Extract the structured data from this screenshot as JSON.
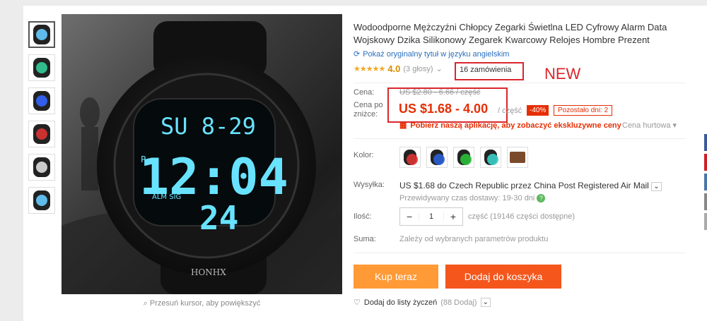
{
  "product": {
    "title": "Wodoodporne Mężczyźni Chłopcy Zegarki Świetlna LED Cyfrowy Alarm Data Wojskowy Dzika Silikonowy Zegarek Kwarcowy Relojes Hombre Prezent",
    "original_title_link": "Pokaż oryginalny tytuł w języku angielskim",
    "stars": "★★★★★",
    "rating": "4.0",
    "votes": "(3 głosy)",
    "orders": "16 zamówienia",
    "annotation": "NEW"
  },
  "pricing": {
    "price_label": "Cena:",
    "old_price": "US $2.80 - 6.66 / część",
    "discount_label": "Cena po zniżce:",
    "price": "US $1.68 - 4.00",
    "unit": "/ część",
    "discount": "-40%",
    "remaining": "Pozostało dni: 2",
    "app_promo": "Pobierz naszą aplikację, aby zobaczyć ekskluzywne ceny",
    "wholesale": "Cena hurtowa ▾"
  },
  "options": {
    "color_label": "Kolor:",
    "colors": [
      "#d33",
      "#2a5fd6",
      "#2bbf3a",
      "#3ad0c8",
      "#7a4b2b"
    ]
  },
  "shipping": {
    "label": "Wysyłka:",
    "text": "US $1.68 do Czech Republic przez China Post Registered Air Mail",
    "delivery": "Przewidywany czas dostawy: 19-30 dni"
  },
  "quantity": {
    "label": "Ilość:",
    "minus": "−",
    "value": "1",
    "plus": "+",
    "available": "część (19146 części dostępne)"
  },
  "total": {
    "label": "Suma:",
    "text": "Zależy od wybranych parametrów produktu"
  },
  "buttons": {
    "buy": "Kup teraz",
    "cart": "Dodaj do koszyka",
    "wishlist": "Dodaj do listy życzeń",
    "wish_count": "(88 Dodaj)"
  },
  "gallery": {
    "zoom_hint": "Przesuń kursor, aby powiększyć",
    "thumb_colors": [
      "#6cf",
      "#3c9",
      "#36f",
      "#d33",
      "#ddd",
      "#6cf"
    ],
    "display": {
      "top": "SU 8-29",
      "time": "12:04",
      "sec": "24",
      "brand": "HONHX",
      "p": "P",
      "alm": "ALM SIG"
    }
  },
  "colors": {
    "accent": "#e62e04",
    "buy": "#ff9a36",
    "cart": "#f4561c",
    "lcd": "#68e3ff"
  }
}
